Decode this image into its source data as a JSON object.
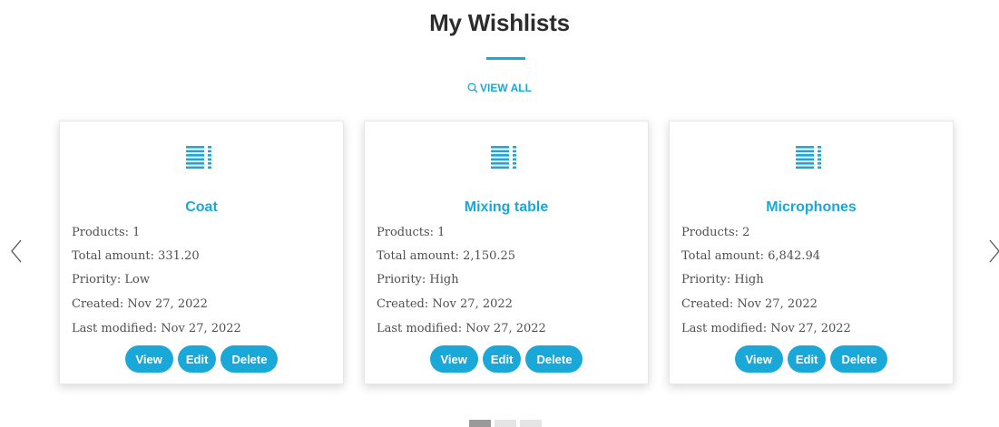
{
  "page": {
    "title": "My Wishlists",
    "view_all": "VIEW ALL",
    "accent_color": "#1aa8d8"
  },
  "carousel": {
    "prev_icon": "chevron-left-icon",
    "next_icon": "chevron-right-icon",
    "dots": 3,
    "active_dot": 1
  },
  "buttons": {
    "view": "View",
    "edit": "Edit",
    "delete": "Delete"
  },
  "wishlists": [
    {
      "name": "Coat",
      "icon": "list-icon",
      "products": "Products: 1",
      "total": "Total amount: 331.20",
      "priority": "Priority: Low",
      "created": "Created: Nov 27, 2022",
      "modified": "Last modified: Nov 27, 2022"
    },
    {
      "name": "Mixing table",
      "icon": "list-icon",
      "products": "Products: 1",
      "total": "Total amount: 2,150.25",
      "priority": "Priority: High",
      "created": "Created: Nov 27, 2022",
      "modified": "Last modified: Nov 27, 2022"
    },
    {
      "name": "Microphones",
      "icon": "list-icon",
      "products": "Products: 2",
      "total": "Total amount: 6,842.94",
      "priority": "Priority: High",
      "created": "Created: Nov 27, 2022",
      "modified": "Last modified: Nov 27, 2022"
    }
  ]
}
